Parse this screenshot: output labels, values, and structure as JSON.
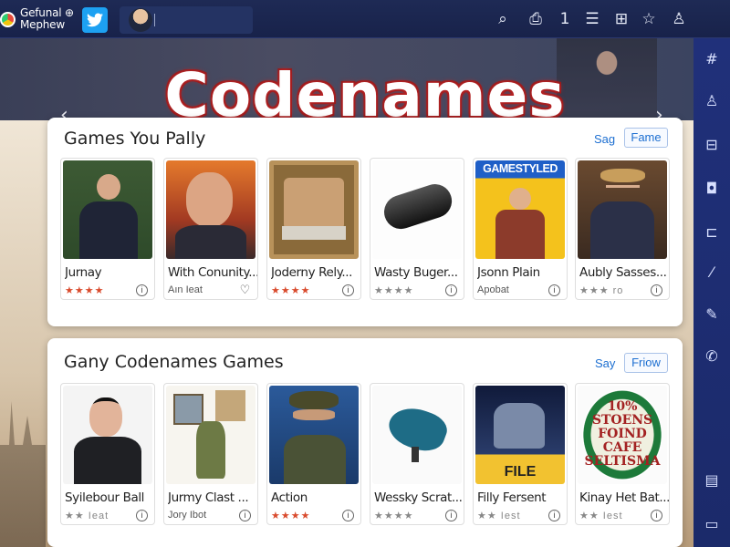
{
  "app_badge": {
    "line1": "Gefunal ⊕",
    "line2": "Mephew"
  },
  "top_icons": [
    "search-icon",
    "lock-icon",
    "one-icon",
    "list-icon",
    "grid-icon",
    "star-icon",
    "user-icon"
  ],
  "top_icon_glyphs": [
    "⌕",
    "⎙",
    "1",
    "☰",
    "⊞",
    "☆",
    "♙"
  ],
  "sidebar_icons": [
    "hash-icon",
    "user-icon",
    "chart-icon",
    "camera-icon",
    "car-icon",
    "brush-icon",
    "pencil-icon",
    "phone-icon",
    "notes-icon",
    "tv-icon"
  ],
  "sidebar_glyphs": [
    "#",
    "♙",
    "⊟",
    "◘",
    "⊏",
    "⁄",
    "✎",
    "✆",
    "▤",
    "▭"
  ],
  "hero": {
    "title": "Codenames"
  },
  "section1": {
    "title": "Games You Pally",
    "link": "Sag",
    "button": "Fame",
    "cards": [
      {
        "name": "Jurnay",
        "meta": "★★★★",
        "meta_style": "stars",
        "meta_icon": "info-icon",
        "meta_glyph": "i",
        "art": "art-suit"
      },
      {
        "name": "With Conunity...",
        "meta": "Aın Ieat",
        "meta_style": "text",
        "meta_icon": "heart-icon",
        "meta_glyph": "♡",
        "art": "art-sunset"
      },
      {
        "name": "Joderny Rely...",
        "meta": "★★★★",
        "meta_style": "stars",
        "meta_icon": "info-icon",
        "meta_glyph": "i",
        "art": "art-frame"
      },
      {
        "name": "Wasty Buger...",
        "meta": "★★★★",
        "meta_style": "grey",
        "meta_icon": "info-icon",
        "meta_glyph": "i",
        "art": "art-tube"
      },
      {
        "name": "Jsonn Plain",
        "meta": "Apobat",
        "meta_style": "text",
        "meta_icon": "info-icon",
        "meta_glyph": "i",
        "art": "art-yellow",
        "art_label": "GAMESTYLED"
      },
      {
        "name": "Aubly Sasses...",
        "meta": "★★★ ro",
        "meta_style": "grey",
        "meta_icon": "info-icon",
        "meta_glyph": "i",
        "art": "art-fedora"
      }
    ]
  },
  "section2": {
    "title": "Gany Codenames Games",
    "link": "Say",
    "button": "Friow",
    "cards": [
      {
        "name": "Syilebour Ball",
        "meta": "★★ Ieat",
        "meta_style": "grey",
        "meta_icon": "info-icon",
        "meta_glyph": "i",
        "art": "art-bald"
      },
      {
        "name": "Jurmy Clast ...",
        "meta": "Jory Ibot",
        "meta_style": "text",
        "meta_icon": "info-icon",
        "meta_glyph": "i",
        "art": "art-soldier"
      },
      {
        "name": "Action",
        "meta": "★★★★",
        "meta_style": "stars",
        "meta_icon": "info-icon",
        "meta_glyph": "i",
        "art": "art-action"
      },
      {
        "name": "Wessky Scrat...",
        "meta": "★★★★",
        "meta_style": "grey",
        "meta_icon": "info-icon",
        "meta_glyph": "i",
        "art": "art-bird"
      },
      {
        "name": "Filly Fersent",
        "meta": "★★ Iest",
        "meta_style": "grey",
        "meta_icon": "info-icon",
        "meta_glyph": "i",
        "art": "art-file",
        "art_label": "FILE"
      },
      {
        "name": "Kinay Het Bat...",
        "meta": "★★ Iest",
        "meta_style": "grey",
        "meta_icon": "info-icon",
        "meta_glyph": "i",
        "art": "art-stone",
        "art_label": "10% STOENS FOIND CAFE SELTISMA"
      }
    ]
  },
  "colors": {
    "accent": "#1d6fd1",
    "topbar": "#1e2a55",
    "sidebar": "#20307a",
    "star": "#d94a2c"
  }
}
